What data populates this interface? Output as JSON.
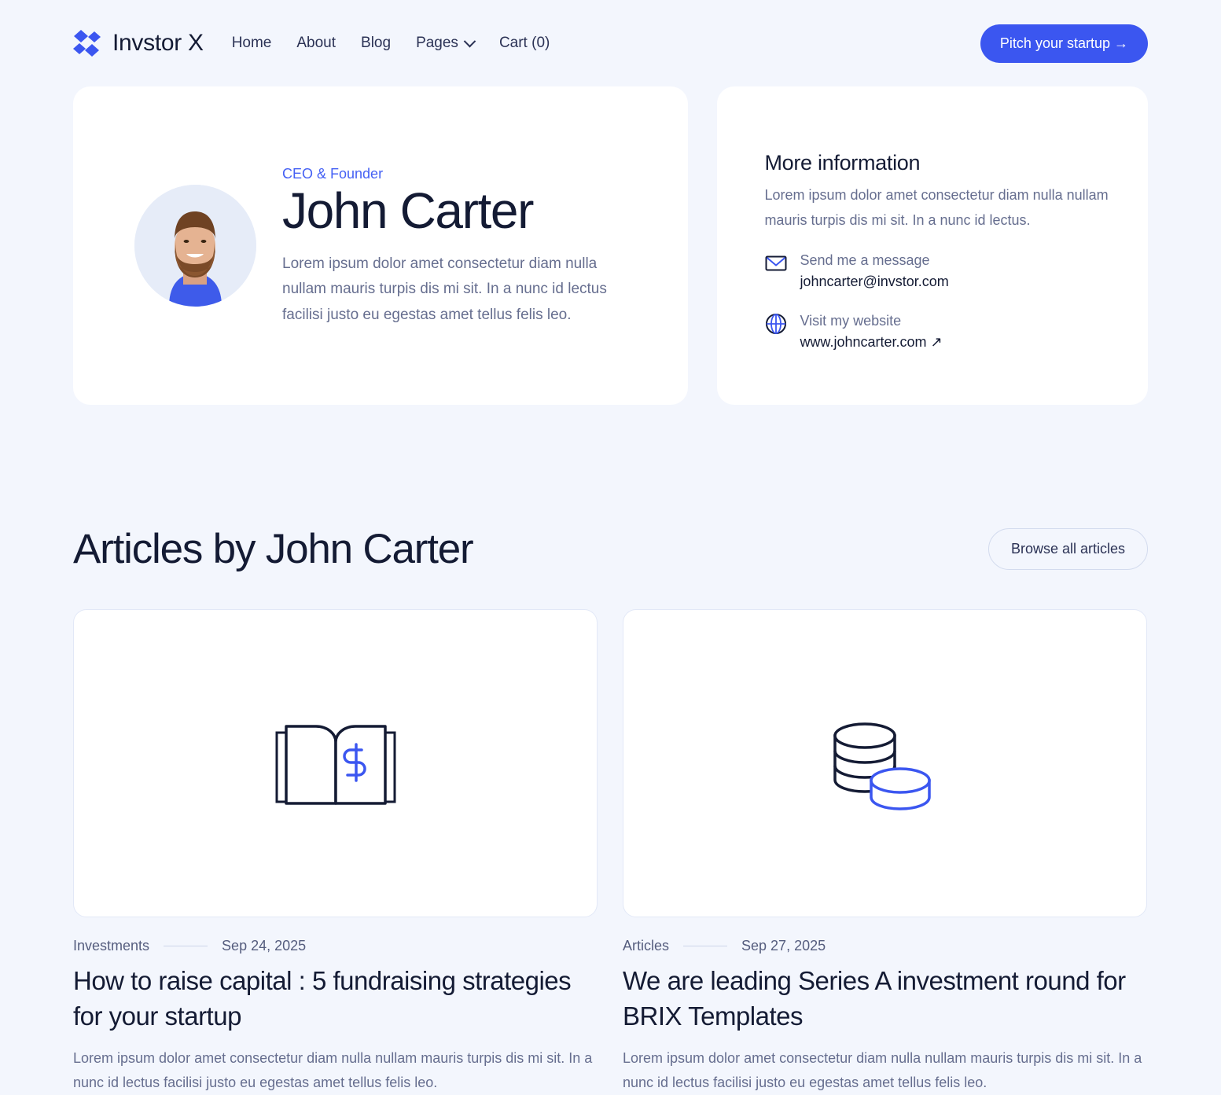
{
  "brand": {
    "name": "Invstor X",
    "logo_icon": "diamonds-logo-icon",
    "accent": "#3b56f0"
  },
  "nav": {
    "links": [
      {
        "label": "Home",
        "icon": null
      },
      {
        "label": "About",
        "icon": null
      },
      {
        "label": "Blog",
        "icon": null
      },
      {
        "label": "Pages",
        "icon": "chevron-down-icon"
      },
      {
        "label": "Cart (0)",
        "icon": null
      }
    ],
    "cta_label": "Pitch your startup →"
  },
  "profile": {
    "avatar_icon": "user-photo-avatar",
    "role": "CEO & Founder",
    "name": "John Carter",
    "bio": "Lorem ipsum dolor amet consectetur diam nulla nullam mauris turpis dis mi sit. In a nunc id lectus facilisi justo eu egestas amet tellus felis leo."
  },
  "more_info": {
    "title": "More information",
    "description": "Lorem ipsum dolor amet consectetur diam nulla nullam mauris turpis dis mi sit. In a nunc id lectus.",
    "contacts": [
      {
        "icon": "envelope-icon",
        "label": "Send me a message",
        "value": "johncarter@invstor.com"
      },
      {
        "icon": "globe-icon",
        "label": "Visit my website",
        "value": "www.johncarter.com ↗"
      }
    ]
  },
  "articles_section": {
    "title": "Articles by John Carter",
    "browse_label": "Browse all articles",
    "items": [
      {
        "thumb_icon": "open-book-dollar-icon",
        "category": "Investments",
        "date": "Sep 24, 2025",
        "title": "How to raise capital : 5 fundraising strategies for your startup",
        "excerpt": "Lorem ipsum dolor amet consectetur diam nulla nullam mauris turpis dis mi sit. In a nunc id lectus facilisi justo eu egestas amet tellus felis leo."
      },
      {
        "thumb_icon": "coin-stack-icon",
        "category": "Articles",
        "date": "Sep 27, 2025",
        "title": "We are leading Series A investment round for BRIX Templates",
        "excerpt": "Lorem ipsum dolor amet consectetur diam nulla nullam mauris turpis dis mi sit. In a nunc id lectus facilisi justo eu egestas amet tellus felis leo."
      }
    ]
  }
}
